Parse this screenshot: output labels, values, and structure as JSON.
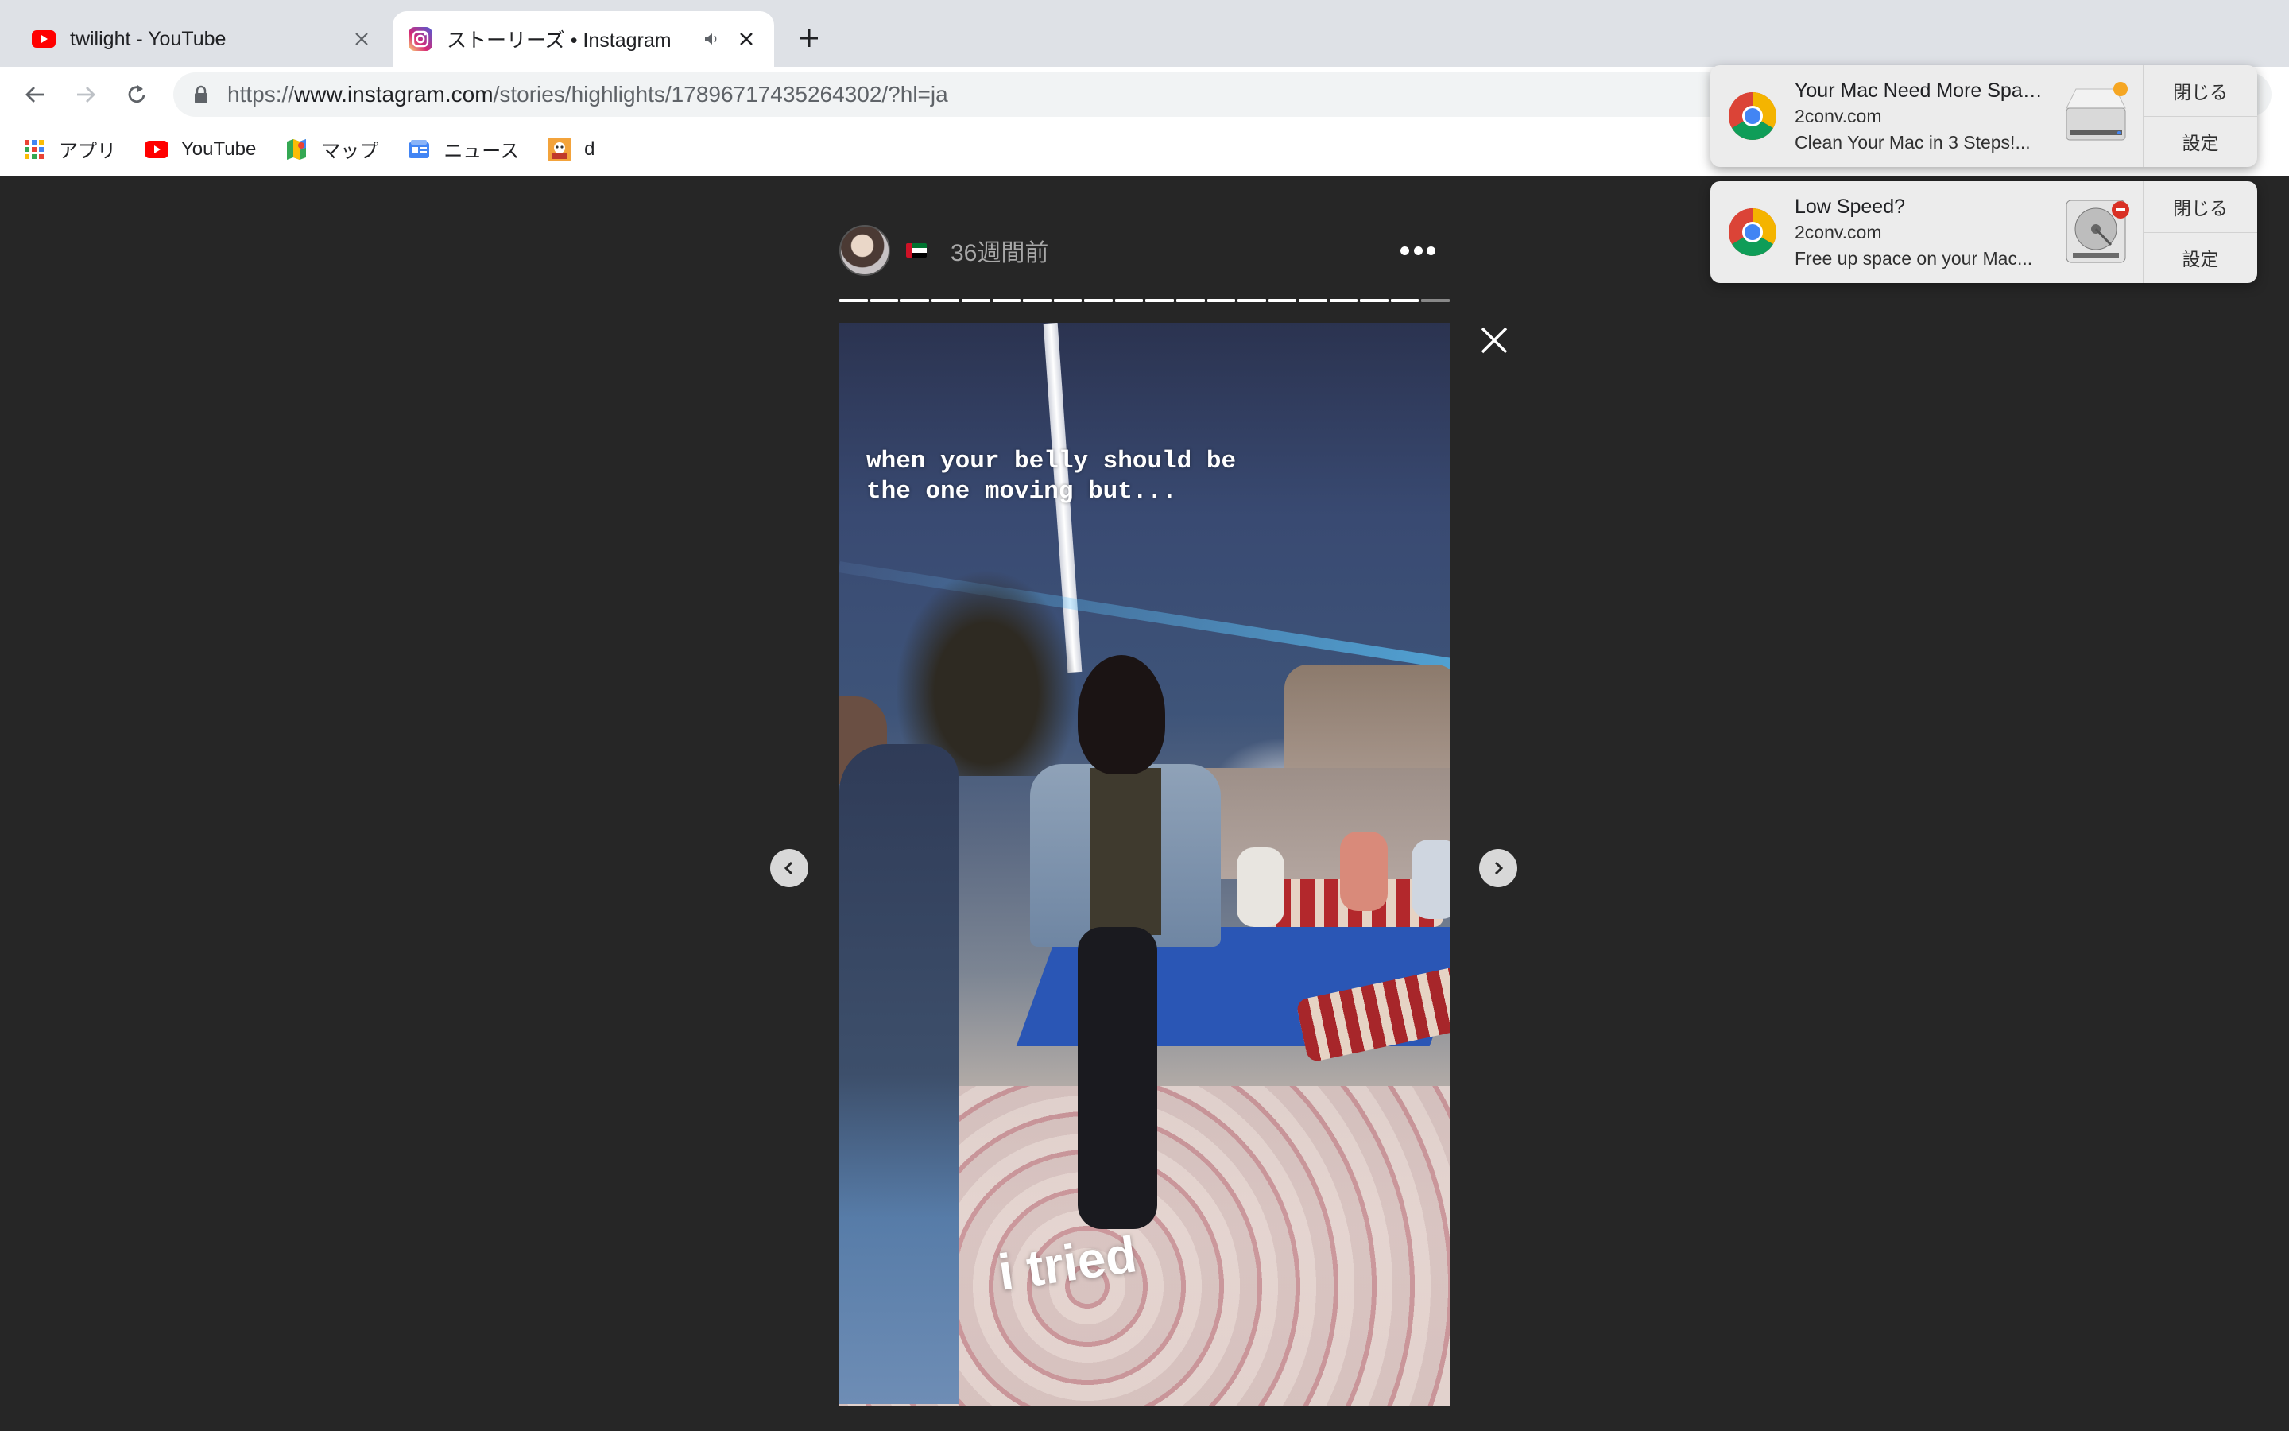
{
  "browser": {
    "tabs": [
      {
        "title": "twilight - YouTube",
        "favicon": "youtube-icon",
        "active": false
      },
      {
        "title": "ストーリーズ • Instagram",
        "favicon": "instagram-icon",
        "active": true,
        "audio": true
      }
    ],
    "new_tab_icon": "plus-icon",
    "url_prefix": "https://",
    "url_host": "www.instagram.com",
    "url_path": "/stories/highlights/17896717435264302/?hl=ja",
    "bookmarks": [
      {
        "label": "アプリ",
        "icon": "apps-grid-icon"
      },
      {
        "label": "YouTube",
        "icon": "youtube-icon"
      },
      {
        "label": "マップ",
        "icon": "maps-icon"
      },
      {
        "label": "ニュース",
        "icon": "news-icon"
      },
      {
        "label": "d",
        "icon": "bookmark-favicon"
      }
    ]
  },
  "story": {
    "time_ago": "36週間前",
    "flag": "uae-flag-icon",
    "caption_top": "when your belly should be\nthe one moving but...",
    "caption_bottom": "i tried",
    "segments_total": 20,
    "segments_viewed": 19
  },
  "notifications": [
    {
      "title": "Your Mac Need More Space...",
      "site": "2conv.com",
      "message": "Clean Your Mac in 3 Steps!...",
      "close_label": "閉じる",
      "settings_label": "設定",
      "badge_color": "#f5a623"
    },
    {
      "title": "Low Speed?",
      "site": "2conv.com",
      "message": "Free up space on your Mac...",
      "close_label": "閉じる",
      "settings_label": "設定",
      "badge_color": "#d93025"
    }
  ]
}
